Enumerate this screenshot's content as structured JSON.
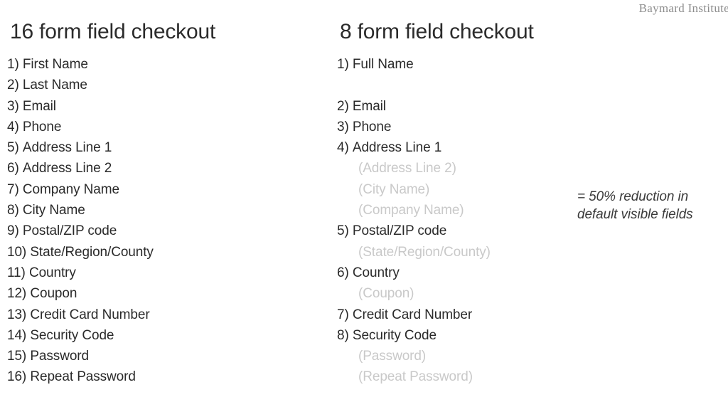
{
  "watermark": {
    "text": "Baymard Institute"
  },
  "columns": {
    "left": {
      "title": "16 form field checkout",
      "rows": [
        {
          "num": "1)",
          "label": "First Name",
          "state": "visible"
        },
        {
          "num": "2)",
          "label": "Last Name",
          "state": "visible"
        },
        {
          "num": "3)",
          "label": "Email",
          "state": "visible"
        },
        {
          "num": "4)",
          "label": "Phone",
          "state": "visible"
        },
        {
          "num": "5)",
          "label": "Address Line 1",
          "state": "visible"
        },
        {
          "num": "6)",
          "label": "Address Line 2",
          "state": "visible"
        },
        {
          "num": "7)",
          "label": "Company Name",
          "state": "visible"
        },
        {
          "num": "8)",
          "label": "City Name",
          "state": "visible"
        },
        {
          "num": "9)",
          "label": "Postal/ZIP code",
          "state": "visible"
        },
        {
          "num": "10)",
          "label": "State/Region/County",
          "state": "visible"
        },
        {
          "num": "11)",
          "label": "Country",
          "state": "visible"
        },
        {
          "num": "12)",
          "label": "Coupon",
          "state": "visible"
        },
        {
          "num": "13)",
          "label": "Credit Card Number",
          "state": "visible"
        },
        {
          "num": "14)",
          "label": "Security Code",
          "state": "visible"
        },
        {
          "num": "15)",
          "label": "Password",
          "state": "visible"
        },
        {
          "num": "16)",
          "label": "Repeat Password",
          "state": "visible"
        }
      ]
    },
    "right": {
      "title": "8 form field checkout",
      "rows": [
        {
          "num": "1)",
          "label": "Full Name",
          "state": "visible"
        },
        {
          "num": "",
          "label": "",
          "state": "blank"
        },
        {
          "num": "2)",
          "label": "Email",
          "state": "visible"
        },
        {
          "num": "3)",
          "label": "Phone",
          "state": "visible"
        },
        {
          "num": "4)",
          "label": "Address Line 1",
          "state": "visible"
        },
        {
          "num": "",
          "label": "(Address Line 2)",
          "state": "muted"
        },
        {
          "num": "",
          "label": "(City Name)",
          "state": "muted"
        },
        {
          "num": "",
          "label": "(Company Name)",
          "state": "muted"
        },
        {
          "num": "5)",
          "label": "Postal/ZIP code",
          "state": "visible"
        },
        {
          "num": "",
          "label": "(State/Region/County)",
          "state": "muted"
        },
        {
          "num": "6)",
          "label": "Country",
          "state": "visible"
        },
        {
          "num": "",
          "label": "(Coupon)",
          "state": "muted"
        },
        {
          "num": "7)",
          "label": "Credit Card Number",
          "state": "visible"
        },
        {
          "num": "8)",
          "label": "Security Code",
          "state": "visible"
        },
        {
          "num": "",
          "label": "(Password)",
          "state": "muted"
        },
        {
          "num": "",
          "label": "(Repeat Password)",
          "state": "muted"
        }
      ]
    }
  },
  "annotation": {
    "line1": "= 50% reduction in",
    "line2": "default visible fields"
  },
  "colors": {
    "background": "#ffffff",
    "text": "#2a2a2a",
    "muted_text": "#c9c9c9",
    "watermark": "#8d8d8d"
  }
}
